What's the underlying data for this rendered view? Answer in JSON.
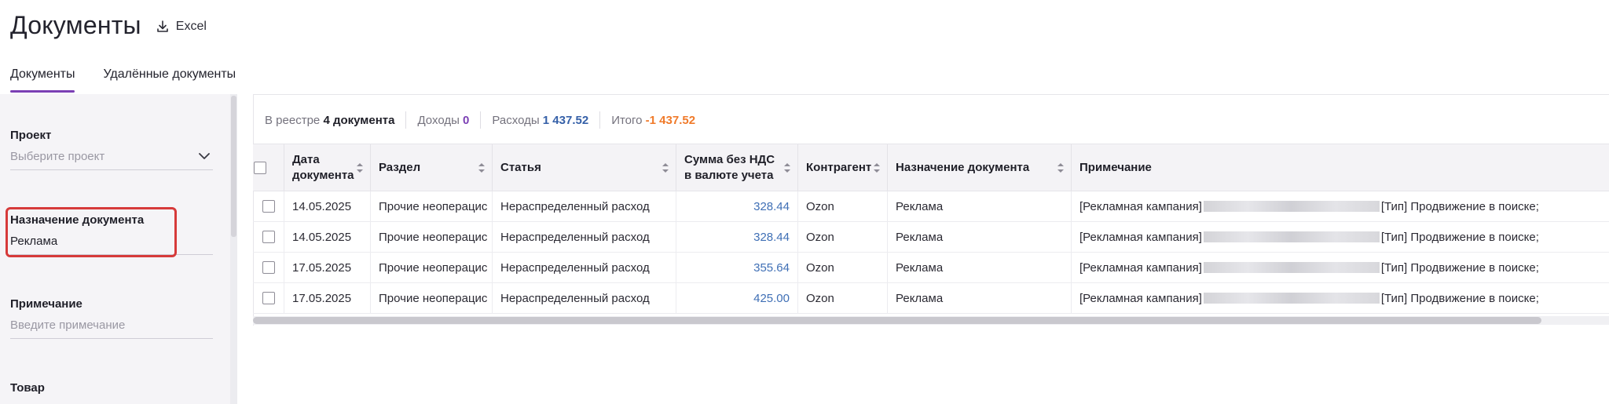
{
  "header": {
    "title": "Документы",
    "excel_label": "Excel"
  },
  "tabs": [
    {
      "label": "Документы",
      "active": true
    },
    {
      "label": "Удалённые документы",
      "active": false
    }
  ],
  "filters": {
    "project": {
      "label": "Проект",
      "placeholder": "Выберите проект"
    },
    "purpose": {
      "label": "Назначение документа",
      "value": "Реклама"
    },
    "note": {
      "label": "Примечание",
      "placeholder": "Введите примечание"
    },
    "product": {
      "label": "Товар"
    }
  },
  "summary": {
    "registry_label": "В реестре",
    "registry_value": "4 документа",
    "income_label": "Доходы",
    "income_value": "0",
    "expense_label": "Расходы",
    "expense_value": "1 437.52",
    "total_label": "Итого",
    "total_value": "-1 437.52"
  },
  "table": {
    "headers": [
      "Дата документа",
      "Раздел",
      "Статья",
      "Сумма без НДС в валюте учета",
      "Контрагент",
      "Назначение документа",
      "Примечание"
    ],
    "rows": [
      {
        "date": "14.05.2025",
        "section": "Прочие неоперацис",
        "article": "Нераспределенный расход",
        "amount": "328.44",
        "counterparty": "Ozon",
        "purpose": "Реклама",
        "note_prefix": "[Рекламная кампания]",
        "note_suffix": "[Тип] Продвижение в поиске;"
      },
      {
        "date": "14.05.2025",
        "section": "Прочие неоперацис",
        "article": "Нераспределенный расход",
        "amount": "328.44",
        "counterparty": "Ozon",
        "purpose": "Реклама",
        "note_prefix": "[Рекламная кампания]",
        "note_suffix": "[Тип] Продвижение в поиске;"
      },
      {
        "date": "17.05.2025",
        "section": "Прочие неоперацис",
        "article": "Нераспределенный расход",
        "amount": "355.64",
        "counterparty": "Ozon",
        "purpose": "Реклама",
        "note_prefix": "[Рекламная кампания]",
        "note_suffix": "[Тип] Продвижение в поиске;"
      },
      {
        "date": "17.05.2025",
        "section": "Прочие неоперацис",
        "article": "Нераспределенный расход",
        "amount": "425.00",
        "counterparty": "Ozon",
        "purpose": "Реклама",
        "note_prefix": "[Рекламная кампания]",
        "note_suffix": "[Тип] Продвижение в поиске;"
      }
    ]
  },
  "colors": {
    "accent": "#7b3fb4",
    "expense": "#3560a8",
    "total": "#f07a2a",
    "highlight": "#d63a3a"
  }
}
